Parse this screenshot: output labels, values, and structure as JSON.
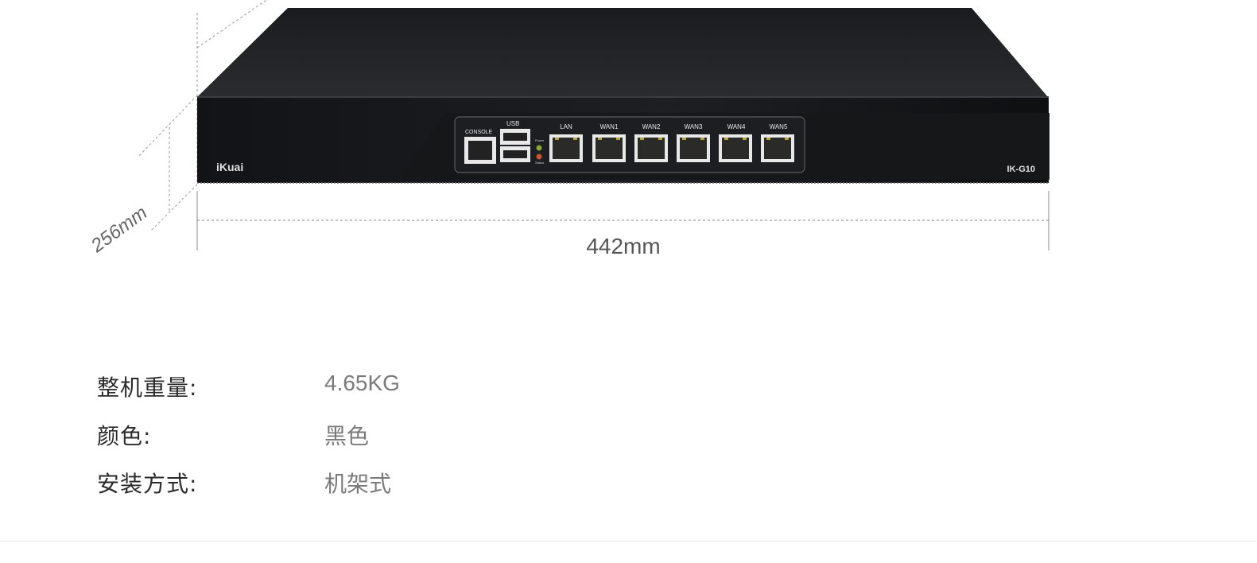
{
  "device": {
    "brand": "iKuai",
    "model": "IK-G10",
    "console_label": "CONSOLE",
    "usb_label": "USB",
    "led_labels": [
      "Power",
      "Status"
    ],
    "ports": [
      "LAN",
      "WAN1",
      "WAN2",
      "WAN3",
      "WAN4",
      "WAN5"
    ],
    "width_label": "442mm",
    "depth_label": "256mm"
  },
  "specs": [
    {
      "label": "整机重量:",
      "value": "4.65KG"
    },
    {
      "label": "颜色:",
      "value": "黑色"
    },
    {
      "label": "安装方式:",
      "value": "机架式"
    }
  ],
  "colors": {
    "chassis": "#1b1c1f",
    "port_frame": "#e8e8e8",
    "label_text": "#2a2a2a",
    "value_text": "#7a7a7a"
  }
}
